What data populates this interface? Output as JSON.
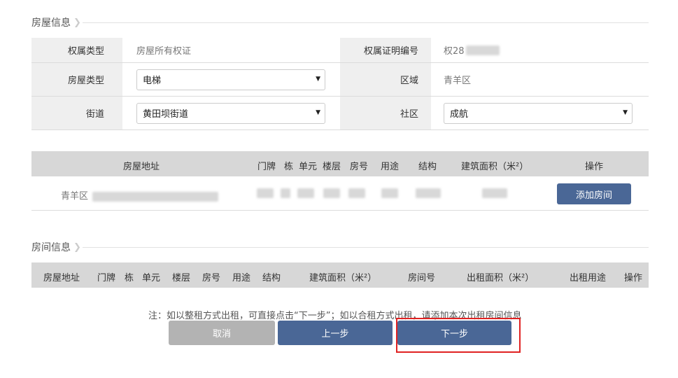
{
  "house_section": {
    "title": "房屋信息"
  },
  "house_info": {
    "ownership_type_label": "权属类型",
    "ownership_type_value": "房屋所有权证",
    "certificate_no_label": "权属证明编号",
    "certificate_no_value": "权28",
    "house_type_label": "房屋类型",
    "house_type_value": "电梯",
    "district_label": "区域",
    "district_value": "青羊区",
    "street_label": "街道",
    "street_value": "黄田坝街道",
    "community_label": "社区",
    "community_value": "成航"
  },
  "house_table": {
    "headers": [
      "房屋地址",
      "门牌",
      "栋",
      "单元",
      "楼层",
      "房号",
      "用途",
      "结构",
      "建筑面积（米²）",
      "操作"
    ],
    "row": {
      "address_prefix": "青羊区",
      "action_label": "添加房间"
    }
  },
  "room_section": {
    "title": "房间信息"
  },
  "room_table": {
    "headers": [
      "房屋地址",
      "门牌",
      "栋",
      "单元",
      "楼层",
      "房号",
      "用途",
      "结构",
      "建筑面积（米²）",
      "房间号",
      "出租面积（米²）",
      "出租用途",
      "操作"
    ]
  },
  "footer": {
    "note": "注：如以整租方式出租，可直接点击“下一步”；如以合租方式出租，请添加本次出租房间信息",
    "cancel_label": "取消",
    "prev_label": "上一步",
    "next_label": "下一步"
  },
  "colors": {
    "primary": "#4a6796",
    "cancel": "#b3b3b3",
    "highlight": "#e02222"
  }
}
